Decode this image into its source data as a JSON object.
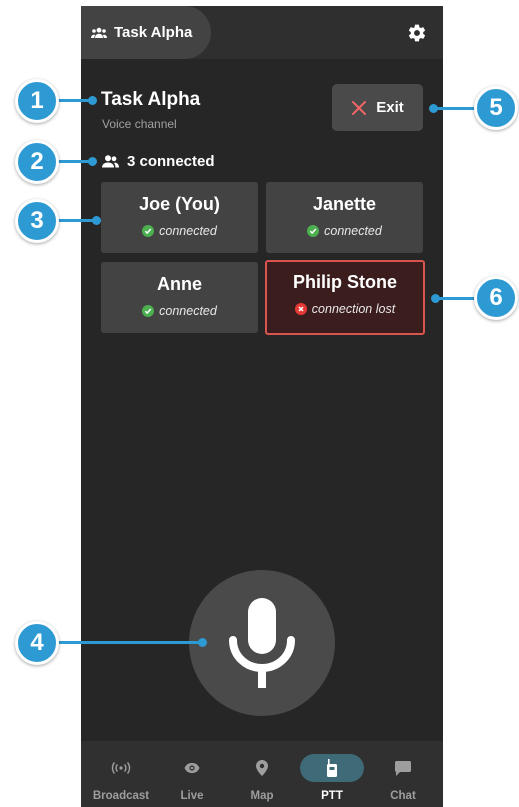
{
  "header": {
    "task_name": "Task Alpha",
    "group_icon": "group-icon",
    "settings_icon": "gear-icon"
  },
  "channel": {
    "title": "Task Alpha",
    "subtitle": "Voice channel"
  },
  "exit_button": {
    "label": "Exit",
    "icon": "close-icon"
  },
  "connected_count": {
    "text": "3 connected",
    "icon": "users-icon"
  },
  "participants": [
    {
      "name": "Joe (You)",
      "status": "connected",
      "state": "ok"
    },
    {
      "name": "Janette",
      "status": "connected",
      "state": "ok"
    },
    {
      "name": "Anne",
      "status": "connected",
      "state": "ok"
    },
    {
      "name": "Philip Stone",
      "status": "connection lost",
      "state": "lost"
    }
  ],
  "mic_button": {
    "icon": "microphone-icon"
  },
  "nav": [
    {
      "label": "Broadcast",
      "icon": "broadcast-icon"
    },
    {
      "label": "Live",
      "icon": "eye-icon"
    },
    {
      "label": "Map",
      "icon": "map-pin-icon"
    },
    {
      "label": "PTT",
      "icon": "walkie-talkie-icon",
      "active": true
    },
    {
      "label": "Chat",
      "icon": "chat-icon"
    }
  ],
  "callouts": [
    "1",
    "2",
    "3",
    "4",
    "5",
    "6"
  ],
  "colors": {
    "accent": "#2e9ad3",
    "ok": "#4caf50",
    "lost": "#e53935",
    "active_nav": "#3f6a77"
  }
}
